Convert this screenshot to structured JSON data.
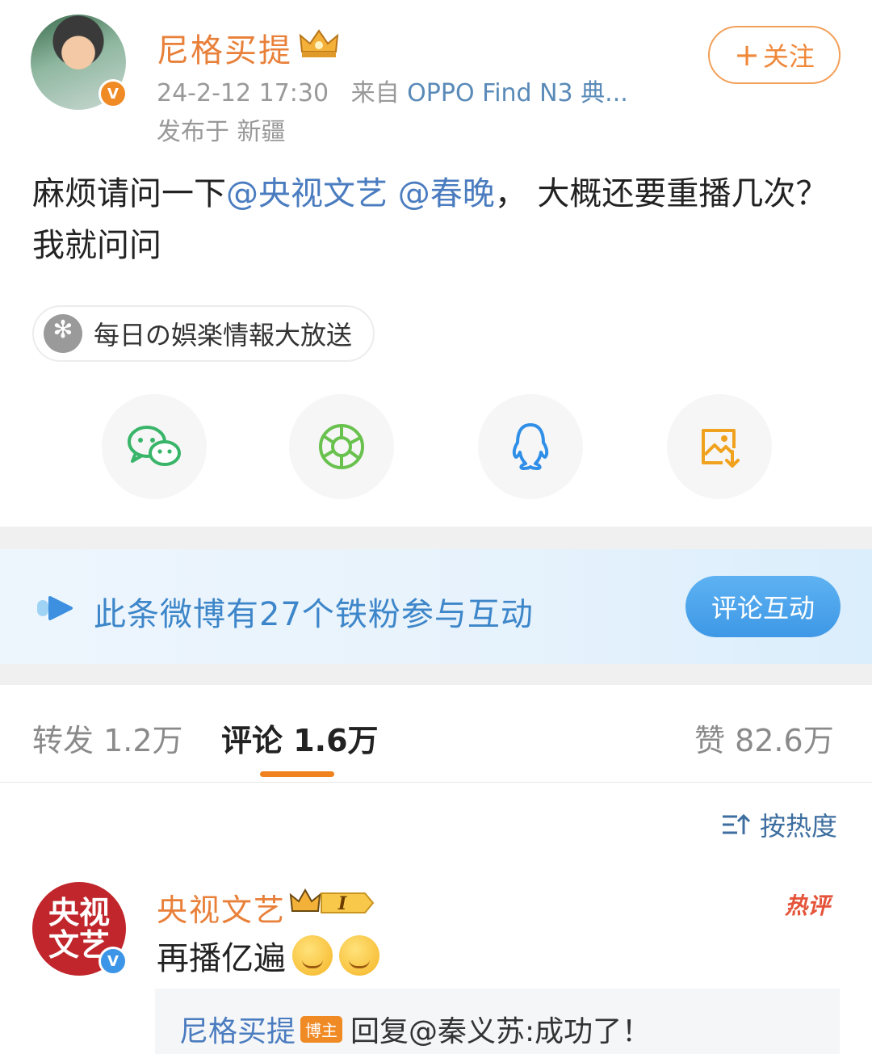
{
  "post": {
    "author": "尼格买提",
    "timestamp": "24-2-12 17:30",
    "source_prefix": "来自",
    "source_device": "OPPO Find N3 典...",
    "location": "发布于 新疆",
    "follow_label": "关注",
    "text_before": "麻烦请问一下",
    "mention_1": "@央视文艺",
    "mention_2": "@春晚",
    "text_after": "，  大概还要重播几次？我就问问",
    "topic": "每日の娯楽情報大放送"
  },
  "share": {
    "icons": [
      "wechat-icon",
      "moments-icon",
      "qq-icon",
      "save-image-icon"
    ]
  },
  "fan_banner": {
    "text": "此条微博有27个铁粉参与互动",
    "button": "评论互动"
  },
  "tabs": {
    "repost": "转发 1.2万",
    "comment": "评论 1.6万",
    "like": "赞 82.6万"
  },
  "sort": {
    "label": "按热度"
  },
  "comment": {
    "author": "央视文艺",
    "avatar_text": [
      "央视",
      "文艺"
    ],
    "level": "I",
    "hot_tag": "热评",
    "text": "再播亿遍",
    "reply_author": "尼格买提",
    "reply_badge": "博主",
    "reply_text": "回复@秦义苏:成功了！"
  },
  "colors": {
    "accent_orange": "#e8803a",
    "link_blue": "#4a7cbf",
    "banner_blue": "#3d86c9"
  }
}
